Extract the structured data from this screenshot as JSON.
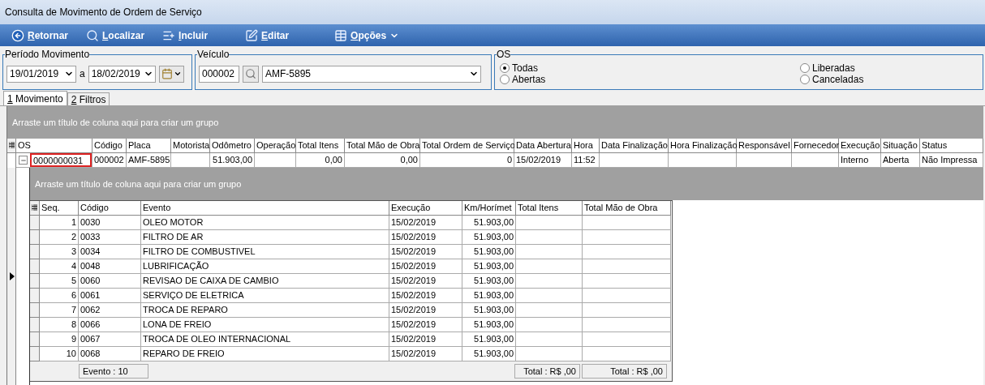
{
  "window": {
    "title": "Consulta de Movimento de Ordem de Serviço"
  },
  "toolbar": [
    {
      "label": "Retornar",
      "kind": "back"
    },
    {
      "label": "Localizar",
      "kind": "find"
    },
    {
      "label": "Incluir",
      "kind": "add"
    },
    {
      "label": "Editar",
      "kind": "edit"
    },
    {
      "label": "Opções",
      "kind": "menu"
    }
  ],
  "periodo": {
    "title": "Período Movimento",
    "from": "19/01/2019",
    "separator": "a",
    "to": "18/02/2019"
  },
  "veiculo": {
    "title": "Veículo",
    "code": "000002",
    "plate": "AMF-5895"
  },
  "os_filter": {
    "title": "OS",
    "options": [
      {
        "label": "Todas",
        "selected": true
      },
      {
        "label": "Abertas",
        "selected": false
      },
      {
        "label": "Liberadas",
        "selected": false
      },
      {
        "label": "Canceladas",
        "selected": false
      }
    ]
  },
  "tabs": [
    {
      "label": "1 Movimento",
      "selected": true
    },
    {
      "label": "2 Filtros",
      "selected": false
    }
  ],
  "grid": {
    "group_hint": "Arraste um título de coluna aqui para criar um grupo",
    "columns": [
      "OS",
      "Código",
      "Placa",
      "Motorista",
      "Odômetro",
      "Operação",
      "Total Itens",
      "Total Mão de Obra",
      "Total Ordem de Serviço",
      "Data Abertura",
      "Hora",
      "Data Finalização",
      "Hora Finalização",
      "Responsável",
      "Fornecedor",
      "Execução",
      "Situação",
      "Status"
    ],
    "rows": [
      {
        "expanded": true,
        "cells": [
          "0000000031",
          "000002",
          "AMF-5895",
          "",
          "51.903,00",
          "",
          "0,00",
          "0,00",
          "0",
          "15/02/2019",
          "11:52",
          "",
          "",
          "",
          "",
          "Interno",
          "Aberta",
          "Não Impressa"
        ]
      }
    ]
  },
  "detail": {
    "group_hint": "Arraste um título de coluna aqui para criar um grupo",
    "columns": [
      "Seq.",
      "Código",
      "Evento",
      "Execução",
      "Km/Horímet",
      "Total Itens",
      "Total Mão de Obra"
    ],
    "rows": [
      [
        "1",
        "0030",
        "OLEO MOTOR",
        "15/02/2019",
        "51.903,00",
        "",
        ""
      ],
      [
        "2",
        "0033",
        "FILTRO DE AR",
        "15/02/2019",
        "51.903,00",
        "",
        ""
      ],
      [
        "3",
        "0034",
        "FILTRO DE COMBUSTIVEL",
        "15/02/2019",
        "51.903,00",
        "",
        ""
      ],
      [
        "4",
        "0048",
        "LUBRIFICAÇÃO",
        "15/02/2019",
        "51.903,00",
        "",
        ""
      ],
      [
        "5",
        "0060",
        "REVISAO DE CAIXA DE CAMBIO",
        "15/02/2019",
        "51.903,00",
        "",
        ""
      ],
      [
        "6",
        "0061",
        "SERVIÇO DE ELETRICA",
        "15/02/2019",
        "51.903,00",
        "",
        ""
      ],
      [
        "7",
        "0062",
        "TROCA DE REPARO",
        "15/02/2019",
        "51.903,00",
        "",
        ""
      ],
      [
        "8",
        "0066",
        "LONA DE FREIO",
        "15/02/2019",
        "51.903,00",
        "",
        ""
      ],
      [
        "9",
        "0067",
        "TROCA DE OLEO INTERNACIONAL",
        "15/02/2019",
        "51.903,00",
        "",
        ""
      ],
      [
        "10",
        "0068",
        "REPARO DE FREIO",
        "15/02/2019",
        "51.903,00",
        "",
        ""
      ]
    ],
    "footer": [
      "Evento : 10",
      "Total : R$ ,00",
      "Total : R$ ,00"
    ]
  }
}
